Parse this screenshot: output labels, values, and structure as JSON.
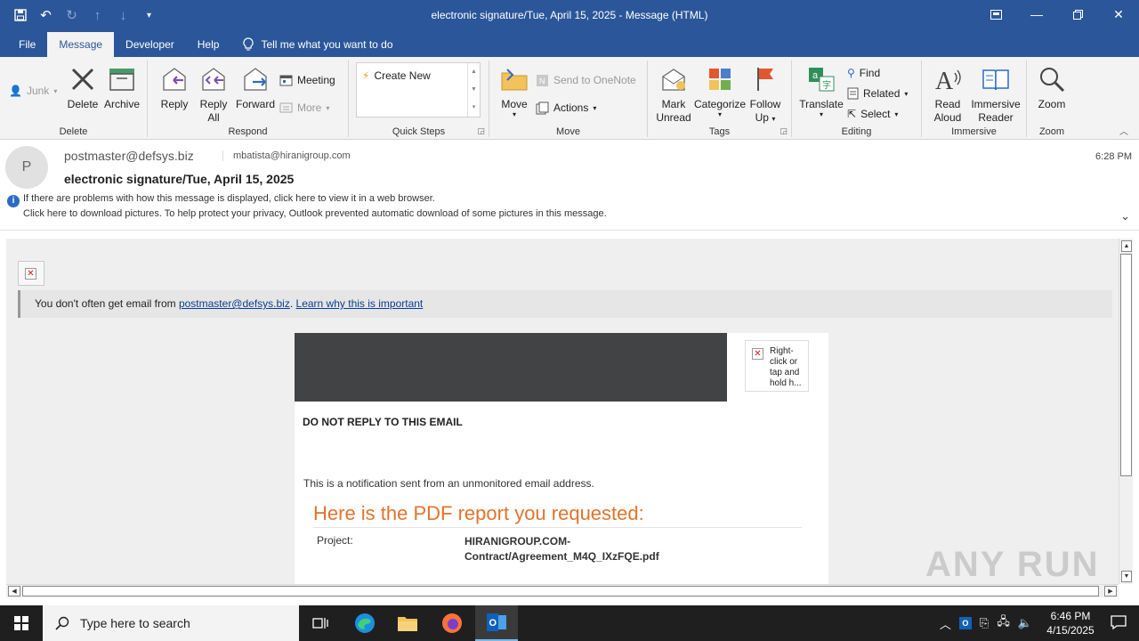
{
  "window": {
    "title": "electronic signature/Tue, April 15, 2025  -  Message (HTML)"
  },
  "tabs": [
    {
      "label": "File"
    },
    {
      "label": "Message"
    },
    {
      "label": "Developer"
    },
    {
      "label": "Help"
    }
  ],
  "tell_me": "Tell me what you want to do",
  "ribbon": {
    "junk": "Junk",
    "delete": "Delete",
    "archive": "Archive",
    "delete_group": "Delete",
    "reply": "Reply",
    "reply_all_1": "Reply",
    "reply_all_2": "All",
    "forward": "Forward",
    "meeting": "Meeting",
    "more": "More",
    "respond_group": "Respond",
    "create_new": "Create New",
    "quicksteps_group": "Quick Steps",
    "move": "Move",
    "send_onenote": "Send to OneNote",
    "actions": "Actions",
    "move_group": "Move",
    "mark_unread_1": "Mark",
    "mark_unread_2": "Unread",
    "categorize": "Categorize",
    "follow_up_1": "Follow",
    "follow_up_2": "Up",
    "tags_group": "Tags",
    "translate": "Translate",
    "find": "Find",
    "related": "Related",
    "select": "Select",
    "editing_group": "Editing",
    "read_aloud_1": "Read",
    "read_aloud_2": "Aloud",
    "immersive_1": "Immersive",
    "immersive_2": "Reader",
    "immersive_group": "Immersive",
    "zoom": "Zoom",
    "zoom_group": "Zoom"
  },
  "message": {
    "avatar_initial": "P",
    "from": "postmaster@defsys.biz",
    "to": "mbatista@hiranigroup.com",
    "subject": "electronic signature/Tue, April 15, 2025",
    "time": "6:28 PM",
    "info_line1": "If there are problems with how this message is displayed, click here to view it in a web browser.",
    "info_line2": "Click here to download pictures. To help protect your privacy, Outlook prevented automatic download of some pictures in this message."
  },
  "email": {
    "warn_text": "You don't often get email from ",
    "warn_link": "postmaster@defsys.biz",
    "warn_sep": ". ",
    "learn_link": "Learn why this is important",
    "img_placeholder": "Right-click or tap and hold h...",
    "do_not_reply": "DO NOT REPLY TO THIS EMAIL",
    "notification": "This is a notification sent from an unmonitored email address.",
    "pdf_heading": "Here is the PDF report you requested:",
    "project_label": "Project:",
    "project_value_1": "HIRANIGROUP.COM-",
    "project_value_2": "Contract/Agreement_M4Q_IXzFQE.pdf"
  },
  "watermark": "ANY RUN",
  "taskbar": {
    "search_placeholder": "Type here to search",
    "time": "6:46 PM",
    "date": "4/15/2025"
  },
  "colors": {
    "brand": "#2b579a",
    "pdf_heading": "#e0742d"
  }
}
